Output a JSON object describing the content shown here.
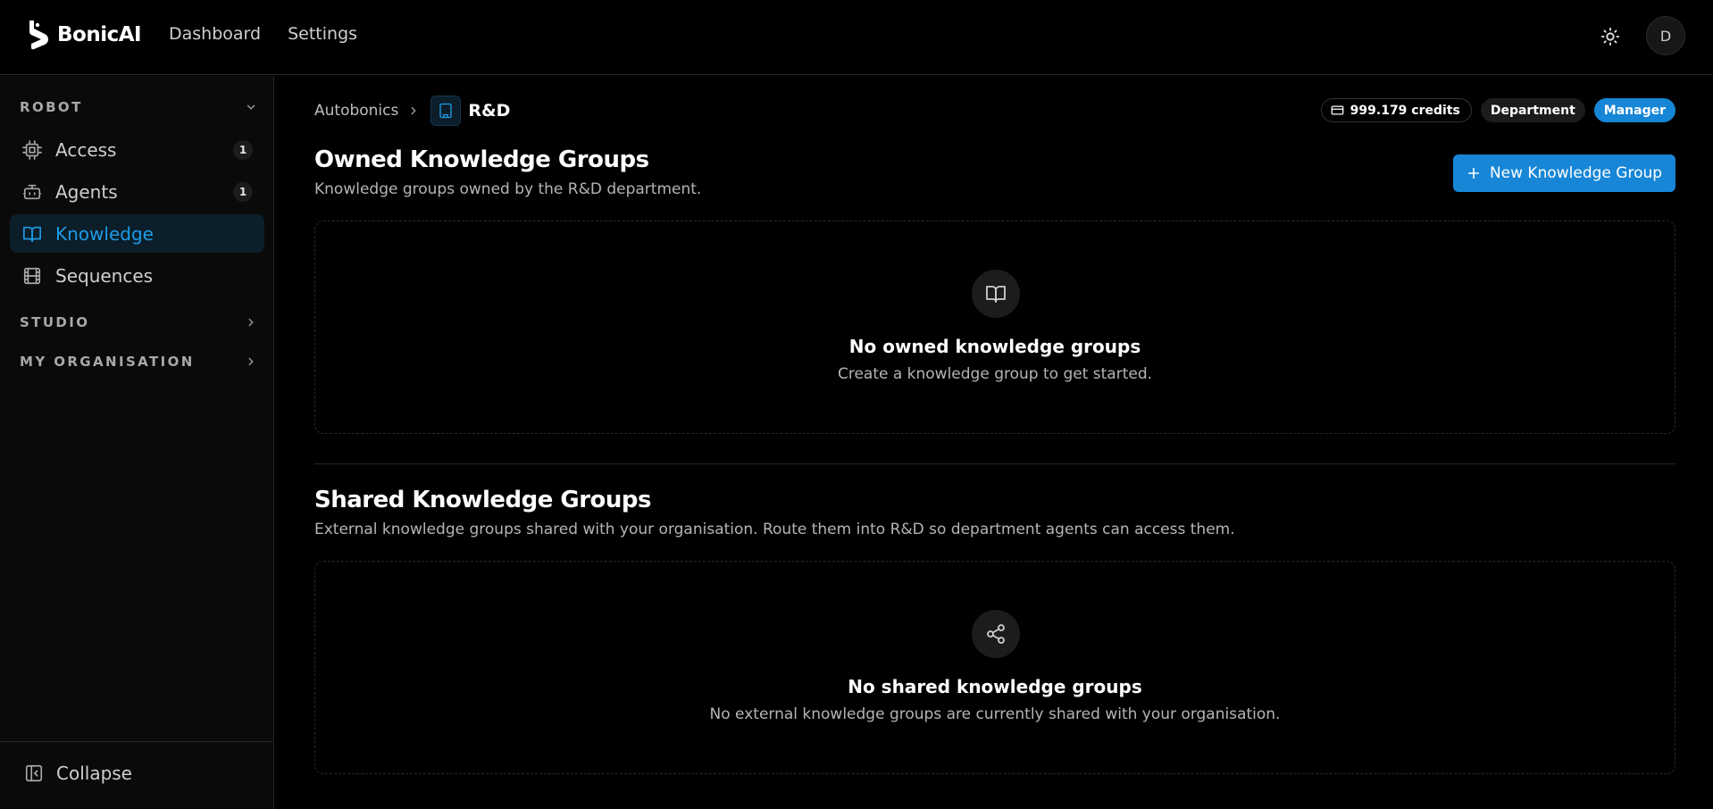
{
  "app": {
    "name": "BonicAI"
  },
  "topnav": {
    "items": [
      {
        "label": "Dashboard"
      },
      {
        "label": "Settings"
      }
    ]
  },
  "user": {
    "initial": "D"
  },
  "sidebar": {
    "sections": [
      {
        "label": "ROBOT",
        "expanded": true
      },
      {
        "label": "STUDIO",
        "expanded": false
      },
      {
        "label": "MY ORGANISATION",
        "expanded": false
      }
    ],
    "items": [
      {
        "label": "Access",
        "count": "1",
        "icon": "cpu-icon"
      },
      {
        "label": "Agents",
        "count": "1",
        "icon": "bot-icon"
      },
      {
        "label": "Knowledge",
        "icon": "book-open-icon",
        "active": true
      },
      {
        "label": "Sequences",
        "icon": "film-icon"
      }
    ],
    "collapse_label": "Collapse"
  },
  "breadcrumb": {
    "org": "Autobonics",
    "department": "R&D"
  },
  "badges": {
    "credits": "999.179 credits",
    "type": "Department",
    "role": "Manager"
  },
  "owned": {
    "title": "Owned Knowledge Groups",
    "subtitle": "Knowledge groups owned by the R&D department.",
    "new_button": "New Knowledge Group",
    "empty_title": "No owned knowledge groups",
    "empty_subtitle": "Create a knowledge group to get started."
  },
  "shared": {
    "title": "Shared Knowledge Groups",
    "subtitle": "External knowledge groups shared with your organisation. Route them into R&D so department agents can access them.",
    "empty_title": "No shared knowledge groups",
    "empty_subtitle": "No external knowledge groups are currently shared with your organisation."
  },
  "colors": {
    "accent": "#1786d6",
    "active_text": "#1d9be6",
    "background": "#000000",
    "sidebar_bg": "#0a0a0a"
  }
}
